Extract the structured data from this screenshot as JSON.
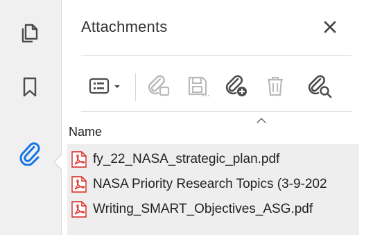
{
  "panel": {
    "title": "Attachments",
    "close_glyph": "×"
  },
  "rail": {
    "items": [
      {
        "icon": "page-thumbnails-icon"
      },
      {
        "icon": "bookmark-icon"
      },
      {
        "icon": "paperclip-icon",
        "active": true
      }
    ]
  },
  "toolbar": {
    "tools": [
      {
        "icon": "view-options-icon",
        "has_dropdown": true,
        "enabled": true
      },
      {
        "icon": "open-attachment-icon",
        "enabled": false
      },
      {
        "icon": "save-attachment-icon",
        "enabled": false
      },
      {
        "icon": "add-attachment-icon",
        "enabled": true
      },
      {
        "icon": "delete-icon",
        "enabled": false
      },
      {
        "icon": "search-attachments-icon",
        "enabled": true
      }
    ]
  },
  "list": {
    "column_name": "Name",
    "sort": "ascending",
    "files": [
      {
        "name": "fy_22_NASA_strategic_plan.pdf",
        "icon": "pdf-file-icon"
      },
      {
        "name": "NASA Priority Research Topics (3-9-202",
        "icon": "pdf-file-icon"
      },
      {
        "name": "Writing_SMART_Objectives_ASG.pdf",
        "icon": "pdf-file-icon"
      }
    ]
  },
  "colors": {
    "accent": "#1473e6",
    "pdf_red": "#d9231f",
    "icon_dark": "#4b4b4b",
    "icon_disabled": "#b9b9b9"
  }
}
